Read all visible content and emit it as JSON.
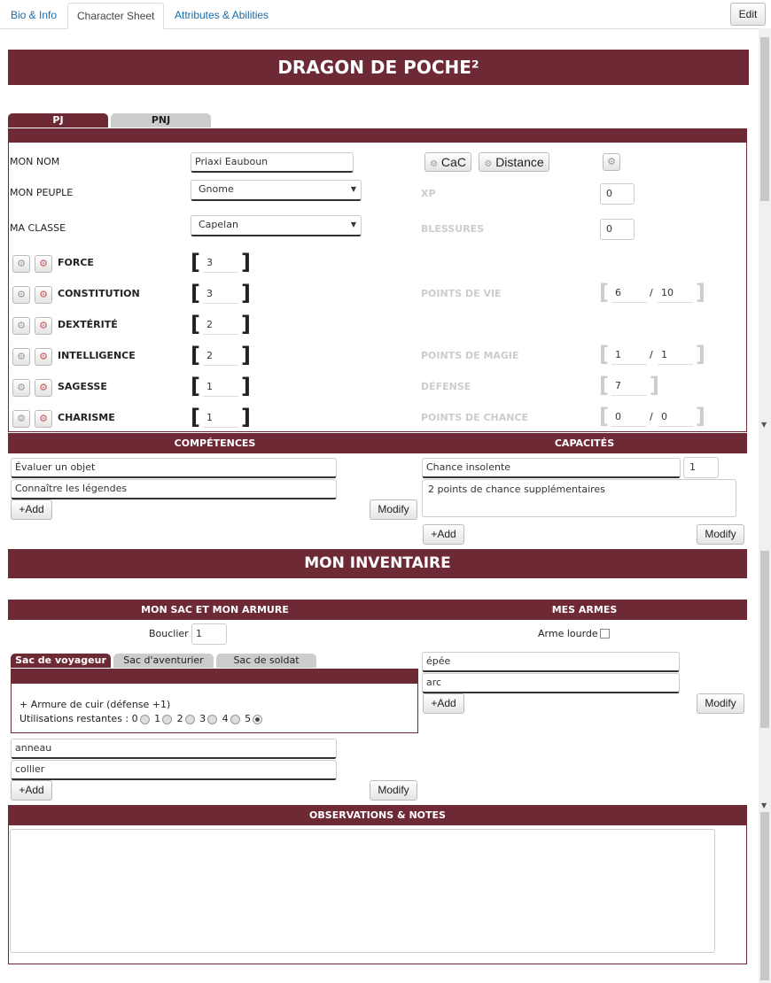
{
  "tabs": [
    "Bio & Info",
    "Character Sheet",
    "Attributes & Abilities"
  ],
  "edit_label": "Edit",
  "title": "DRAGON DE POCHE²",
  "mode_tabs": [
    "PJ",
    "PNJ"
  ],
  "identity": {
    "name_label": "MON NOM",
    "name_value": "Priaxi Eauboun",
    "race_label": "MON PEUPLE",
    "race_value": "Gnome",
    "class_label": "MA CLASSE",
    "class_value": "Capelan"
  },
  "rolls": {
    "cac": "CaC",
    "distance": "Distance"
  },
  "xp": {
    "label": "XP",
    "value": "0"
  },
  "wounds": {
    "label": "BLESSURES",
    "value": "0"
  },
  "stats": [
    {
      "label": "FORCE",
      "value": "3"
    },
    {
      "label": "CONSTITUTION",
      "value": "3"
    },
    {
      "label": "DEXTÉRITÉ",
      "value": "2"
    },
    {
      "label": "INTELLIGENCE",
      "value": "2"
    },
    {
      "label": "SAGESSE",
      "value": "1"
    },
    {
      "label": "CHARISME",
      "value": "1"
    }
  ],
  "pools": {
    "hp": {
      "label": "POINTS DE VIE",
      "current": "6",
      "max": "10"
    },
    "mp": {
      "label": "POINTS DE MAGIE",
      "current": "1",
      "max": "1"
    },
    "defense": {
      "label": "DÉFENSE",
      "value": "7"
    },
    "luck": {
      "label": "POINTS DE CHANCE",
      "current": "0",
      "max": "0"
    },
    "separator": "/"
  },
  "skills": {
    "header": "COMPÉTENCES",
    "items": [
      "Évaluer un objet",
      "Connaître les légendes"
    ],
    "add": "+Add",
    "modify": "Modify"
  },
  "abilities": {
    "header": "CAPACITÉS",
    "name": "Chance insolente",
    "count": "1",
    "description": "2 points de chance supplémentaires",
    "add": "+Add",
    "modify": "Modify"
  },
  "inventory": {
    "title": "MON INVENTAIRE",
    "bag_header": "MON SAC ET MON ARMURE",
    "weapons_header": "MES ARMES",
    "shield_label": "Bouclier",
    "shield_value": "1",
    "heavy_label": "Arme lourde",
    "bag_tabs": [
      "Sac de voyageur",
      "Sac d'aventurier",
      "Sac de soldat"
    ],
    "armor": "+ Armure de cuir (défense +1)",
    "uses_label": "Utilisations restantes :",
    "uses_options": [
      "0",
      "1",
      "2",
      "3",
      "4",
      "5"
    ],
    "uses_selected": "5",
    "bag_items": [
      "anneau",
      "collier"
    ],
    "weapons": [
      "épée",
      "arc"
    ],
    "add": "+Add",
    "modify": "Modify"
  },
  "notes": {
    "header": "OBSERVATIONS & NOTES",
    "value": ""
  }
}
